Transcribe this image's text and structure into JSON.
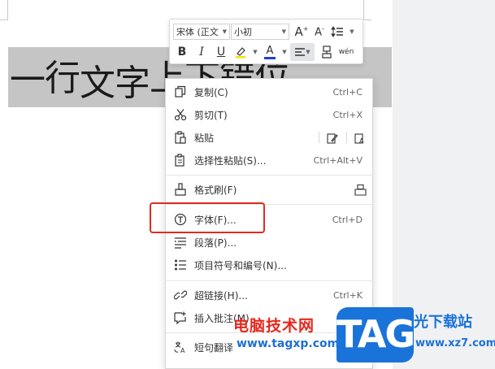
{
  "document": {
    "selected_text_chars": [
      "一",
      "行",
      "文",
      "字",
      "上",
      "下",
      "错",
      "位"
    ]
  },
  "mini_toolbar": {
    "font_name": "宋体 (正文",
    "font_size": "小初",
    "grow_font": "A",
    "shrink_font": "A",
    "bold": "B",
    "italic": "I",
    "underline": "U",
    "font_color": "A",
    "phonetic": "wén"
  },
  "context_menu": {
    "items": [
      {
        "label": "复制(C)",
        "shortcut": "Ctrl+C"
      },
      {
        "label": "剪切(T)",
        "shortcut": "Ctrl+X"
      },
      {
        "label": "粘贴",
        "shortcut": ""
      },
      {
        "label": "选择性粘贴(S)...",
        "shortcut": "Ctrl+Alt+V"
      },
      {
        "label": "格式刷(F)",
        "shortcut": ""
      },
      {
        "label": "字体(F)...",
        "shortcut": "Ctrl+D"
      },
      {
        "label": "段落(P)...",
        "shortcut": ""
      },
      {
        "label": "项目符号和编号(N)...",
        "shortcut": ""
      },
      {
        "label": "超链接(H)...",
        "shortcut": "Ctrl+K"
      },
      {
        "label": "插入批注(M)",
        "shortcut": ""
      },
      {
        "label": "短句翻译",
        "shortcut": ""
      }
    ]
  },
  "watermark": {
    "cn_name": "电脑技术网",
    "url": "www.tagxp.com",
    "logo": "TAG",
    "site_name": "光下载站",
    "site_url": "www.xz7.com"
  },
  "colors": {
    "highlight_box": "#e02b1f",
    "font_color_bar": "#1f3fd6",
    "highlight_bar": "#f5e300",
    "watermark_blue": "#1a73d9",
    "watermark_red": "#e5281d"
  }
}
